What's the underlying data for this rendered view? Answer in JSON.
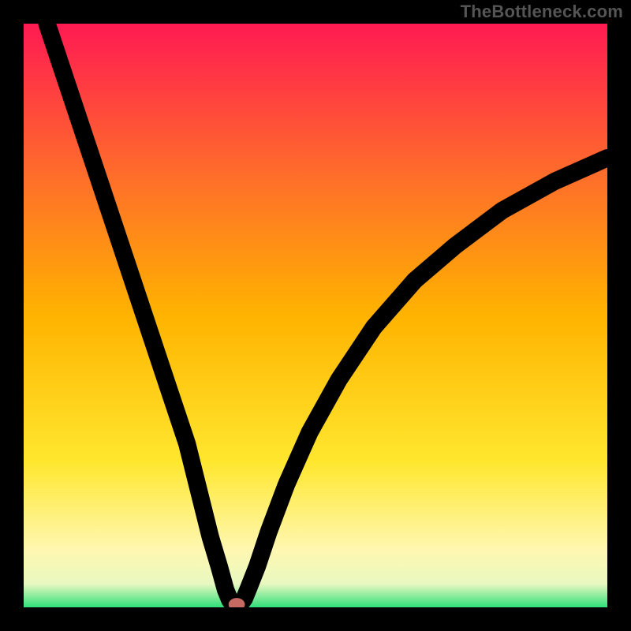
{
  "watermark": "TheBottleneck.com",
  "chart_data": {
    "type": "line",
    "title": "",
    "xlabel": "",
    "ylabel": "",
    "xlim": [
      0,
      100
    ],
    "ylim": [
      0,
      100
    ],
    "grid": false,
    "legend": false,
    "gradient_stops": [
      {
        "offset": 0,
        "color": "#ff1a52"
      },
      {
        "offset": 25,
        "color": "#ff6a2c"
      },
      {
        "offset": 50,
        "color": "#ffb300"
      },
      {
        "offset": 75,
        "color": "#ffe72e"
      },
      {
        "offset": 90,
        "color": "#fff7b0"
      },
      {
        "offset": 96,
        "color": "#e8f8c0"
      },
      {
        "offset": 100,
        "color": "#2fe07a"
      }
    ],
    "series": [
      {
        "name": "bottleneck-curve",
        "x": [
          4,
          7,
          10,
          13,
          16,
          19,
          22,
          25,
          28,
          30,
          32,
          33.5,
          34.6,
          35.3,
          35.8,
          36.5
        ],
        "y": [
          100,
          91,
          82,
          73,
          64,
          55,
          46,
          37,
          28,
          20,
          12,
          7,
          3,
          1.3,
          0.6,
          0
        ]
      },
      {
        "name": "bottleneck-curve-right",
        "x": [
          36.5,
          37.2,
          37.8,
          38.5,
          40,
          42,
          45,
          49,
          54,
          60,
          67,
          74,
          82,
          91,
          100
        ],
        "y": [
          0,
          0.7,
          1.5,
          3.2,
          7,
          13,
          21,
          30,
          39,
          48,
          56,
          62,
          68,
          73,
          77
        ]
      }
    ],
    "bottleneck_point": {
      "x": 36.5,
      "y": 0.5,
      "rx": 1.4,
      "ry": 1.1,
      "color": "#c76a62"
    }
  }
}
